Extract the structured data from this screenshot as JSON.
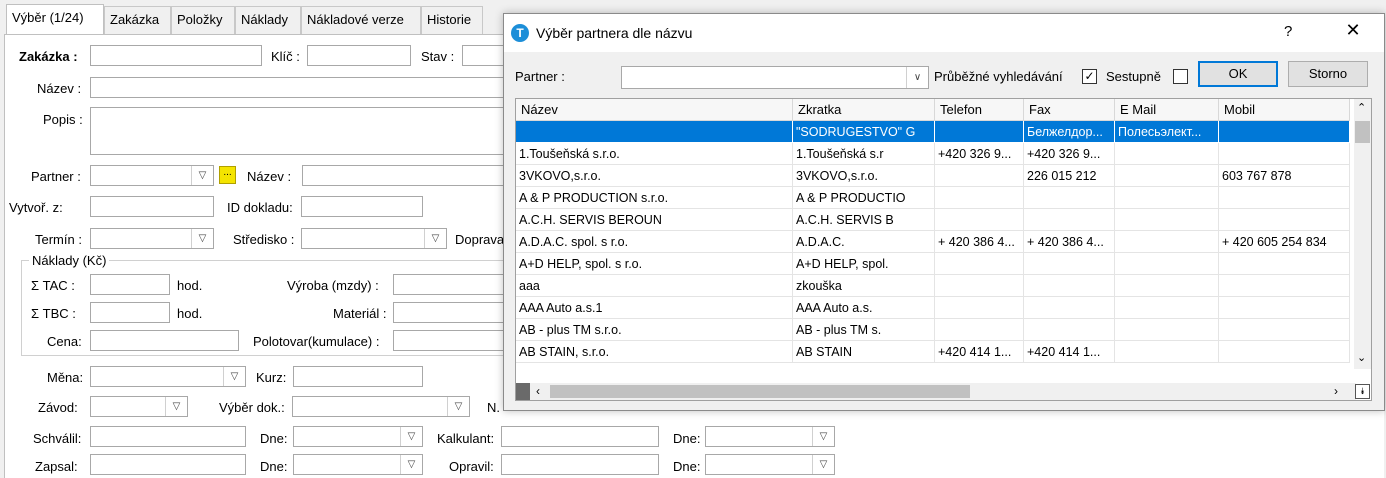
{
  "tabs": [
    "Výběr (1/24)",
    "Zakázka",
    "Položky",
    "Náklady",
    "Nákladové verze",
    "Historie"
  ],
  "form": {
    "zakazka_label": "Zakázka :",
    "klic_label": "Klíč :",
    "stav_label": "Stav :",
    "nazev_label": "Název :",
    "popis_label": "Popis :",
    "partner_label": "Partner :",
    "partner_btn": "...",
    "partner_nazev_label": "Název :",
    "vytvor_label": "Vytvoř. z:",
    "id_dokladu_label": "ID dokladu:",
    "termin_label": "Termín :",
    "stredisko_label": "Středisko :",
    "doprava_label": "Doprava",
    "naklady_group": "Náklady (Kč)",
    "tac_label": "Σ  TAC :",
    "tbc_label": "Σ  TBC :",
    "hod1": "hod.",
    "hod2": "hod.",
    "vyroba_label": "Výroba (mzdy) :",
    "material_label": "Materiál :",
    "cena_label": "Cena:",
    "polotovar_label": "Polotovar(kumulace) :",
    "mena_label": "Měna:",
    "kurz_label": "Kurz:",
    "zavod_label": "Závod:",
    "vyber_dok_label": "Výběr dok.:",
    "n_label": "N.",
    "schvalil_label": "Schválil:",
    "dne1_label": "Dne:",
    "kalkulant_label": "Kalkulant:",
    "dne2_label": "Dne:",
    "zapsal_label": "Zapsal:",
    "dne3_label": "Dne:",
    "opravil_label": "Opravil:",
    "dne4_label": "Dne:"
  },
  "dialog": {
    "icon": "T",
    "title": "Výběr partnera dle názvu",
    "help": "?",
    "close": "✕",
    "partner_label": "Partner :",
    "partner_value": "",
    "prubezne_label": "Průběžné vyhledávání",
    "prubezne_checked": true,
    "sestupne_label": "Sestupně",
    "sestupne_checked": false,
    "ok_label": "OK",
    "storno_label": "Storno",
    "columns": [
      "Název",
      "Zkratka",
      "Telefon",
      "Fax",
      "E Mail",
      "Mobil"
    ],
    "rows": [
      [
        "",
        "\"SODRUGESTVO\" G",
        "",
        "Белжелдор...",
        "Полесьэлект...",
        ""
      ],
      [
        "1.Toušeňská s.r.o.",
        "1.Toušeňská s.r",
        "+420 326 9...",
        "+420 326 9...",
        "",
        ""
      ],
      [
        "3VKOVO,s.r.o.",
        "3VKOVO,s.r.o.",
        "",
        "226 015 212",
        "",
        "603 767 878"
      ],
      [
        "A & P PRODUCTION s.r.o.",
        "A & P PRODUCTIO",
        "",
        "",
        "",
        ""
      ],
      [
        "A.C.H. SERVIS BEROUN",
        "A.C.H. SERVIS B",
        "",
        "",
        "",
        ""
      ],
      [
        "A.D.A.C. spol. s r.o.",
        "A.D.A.C.",
        "+ 420 386 4...",
        "+ 420 386 4...",
        "",
        "+ 420 605 254 834"
      ],
      [
        "A+D HELP, spol. s r.o.",
        "A+D HELP, spol.",
        "",
        "",
        "",
        ""
      ],
      [
        "aaa",
        "zkouška",
        "",
        "",
        "",
        ""
      ],
      [
        "AAA Auto a.s.1",
        "AAA Auto a.s.",
        "",
        "",
        "",
        ""
      ],
      [
        "AB - plus TM s.r.o.",
        "AB - plus TM s.",
        "",
        "",
        "",
        ""
      ],
      [
        "AB STAIN, s.r.o.",
        "AB STAIN",
        "+420 414 1...",
        "+420 414 1...",
        "",
        ""
      ]
    ],
    "selected_row": 0
  }
}
